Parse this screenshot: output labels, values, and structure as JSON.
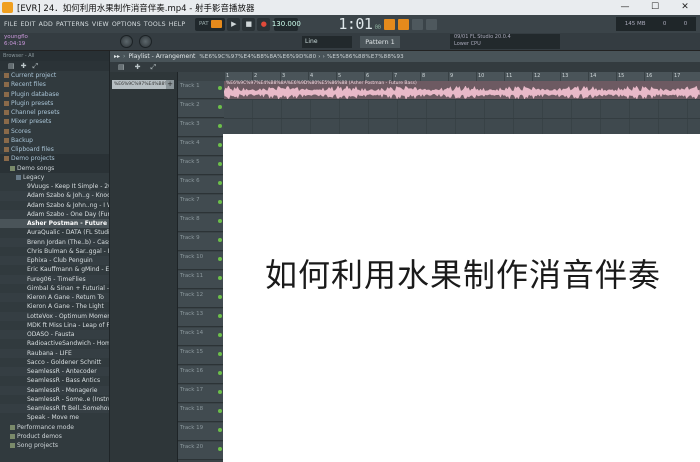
{
  "window": {
    "title": "[EVR] 24．如何利用水果制作消音伴奏.mp4 - 射手影音播放器",
    "minimize": "—",
    "maximize": "☐",
    "close": "✕"
  },
  "menu": [
    "FILE",
    "EDIT",
    "ADD",
    "PATTERNS",
    "VIEW",
    "OPTIONS",
    "TOOLS",
    "HELP"
  ],
  "transport": {
    "pat_label": "PAT",
    "play": "▶",
    "stop": "■",
    "record": "●",
    "tempo": "130.000",
    "time": "1:01",
    "time_small": "00",
    "time_unit": "B:S:T"
  },
  "cpu": {
    "mem": "145 MB",
    "cpu": "0",
    "voices": "0"
  },
  "toolbar2": {
    "user": "youngflo",
    "user_time": "6:04:19",
    "track_label": "Track 16",
    "line": "Line",
    "pattern": "Pattern 1"
  },
  "plugin_info": {
    "line1": "09/01  FL Studio 20.0.4",
    "line2": "Lower CPU"
  },
  "browser": {
    "header": "Browser - All",
    "items": [
      {
        "label": "Current project",
        "level": "lvl0"
      },
      {
        "label": "Recent files",
        "level": "lvl0"
      },
      {
        "label": "Plugin database",
        "level": "lvl0"
      },
      {
        "label": "Plugin presets",
        "level": "lvl0"
      },
      {
        "label": "Channel presets",
        "level": "lvl0"
      },
      {
        "label": "Mixer presets",
        "level": "lvl0"
      },
      {
        "label": "Scores",
        "level": "lvl0"
      },
      {
        "label": "Backup",
        "level": "lvl0"
      },
      {
        "label": "Clipboard files",
        "level": "lvl0"
      },
      {
        "label": "Demo projects",
        "level": "lvl0 folder-open"
      },
      {
        "label": "Demo songs",
        "level": "lvl1 folder-open"
      },
      {
        "label": "Legacy",
        "level": "lvl2"
      },
      {
        "label": "9Vuugs - Keep It Simple - 2015",
        "level": "file"
      },
      {
        "label": "Adam Szabo & Joh..g - Knock Me Out",
        "level": "file alt"
      },
      {
        "label": "Adam Szabo & John..ng - I Wanna Be",
        "level": "file"
      },
      {
        "label": "Adam Szabo - One Day (Funky Mix)",
        "level": "file alt"
      },
      {
        "label": "Asher Postman - Future Bass",
        "level": "file selected"
      },
      {
        "label": "AuraQualic - DATA (FL Studio Remix)",
        "level": "file"
      },
      {
        "label": "Brenn Jordan (The..b) - Cassette Cafe",
        "level": "file alt"
      },
      {
        "label": "Chris Bulman & Sar..ggal - No Escape",
        "level": "file"
      },
      {
        "label": "Ephixa - Club Penguin",
        "level": "file alt"
      },
      {
        "label": "Eric Kauffmann & gMind - Empirent",
        "level": "file"
      },
      {
        "label": "Fureg06 - TimeFlies",
        "level": "file alt"
      },
      {
        "label": "Gimbal & Sinan + Futurial - RawRL",
        "level": "file"
      },
      {
        "label": "Kieron A Gane - Return To",
        "level": "file alt"
      },
      {
        "label": "Kieron A Gane - The Light",
        "level": "file"
      },
      {
        "label": "LotteVox - Optimum Momentum",
        "level": "file alt"
      },
      {
        "label": "MDK ft Miss Lina - Leap of Faith",
        "level": "file"
      },
      {
        "label": "ODASO - Fausta",
        "level": "file alt"
      },
      {
        "label": "RadioactiveSandwich - Homunculus",
        "level": "file"
      },
      {
        "label": "Raubana - LIFE",
        "level": "file alt"
      },
      {
        "label": "Sacco - Goldener Schnitt",
        "level": "file"
      },
      {
        "label": "SeamlessR - Antecoder",
        "level": "file alt"
      },
      {
        "label": "SeamlessR - Bass Antics",
        "level": "file"
      },
      {
        "label": "SeamlessR - Menagerie",
        "level": "file alt"
      },
      {
        "label": "SeamlessR - Some..e (Instrumental)",
        "level": "file"
      },
      {
        "label": "SeamlessR ft Bell..Somehow (Vocal)",
        "level": "file alt"
      },
      {
        "label": "Speak - Move me",
        "level": "file"
      },
      {
        "label": "Performance mode",
        "level": "lvl1"
      },
      {
        "label": "Product demos",
        "level": "lvl1"
      },
      {
        "label": "Song projects",
        "level": "lvl1"
      }
    ]
  },
  "playlist": {
    "title": "Playlist - Arrangement",
    "path": "%E6%9C%97%E4%B8%8A%E6%9D%80 › › %E5%86%88%E7%88%93",
    "pattern_item": "%E6%9C%97%E4%B8%8A%E6%9D",
    "pattern_add": "+",
    "clip_label": "%E6%9C%97%E4%B8%8A%E6%9D%80%E5%86%88 (Asher Postman - Future Bass)",
    "ruler": [
      "1",
      "2",
      "3",
      "4",
      "5",
      "6",
      "7",
      "8",
      "9",
      "10",
      "11",
      "12",
      "13",
      "14",
      "15",
      "16",
      "17"
    ],
    "tracks": [
      "Track 1",
      "Track 2",
      "Track 3",
      "Track 4",
      "Track 5",
      "Track 6",
      "Track 7",
      "Track 8",
      "Track 9",
      "Track 10",
      "Track 11",
      "Track 12",
      "Track 13",
      "Track 14",
      "Track 15",
      "Track 16",
      "Track 17",
      "Track 18",
      "Track 19",
      "Track 20"
    ]
  },
  "overlay": {
    "title": "如何利用水果制作消音伴奏"
  },
  "colors": {
    "accent": "#e58a1c",
    "clip": "#6d5a62",
    "waveform": "#e8b9c8"
  }
}
